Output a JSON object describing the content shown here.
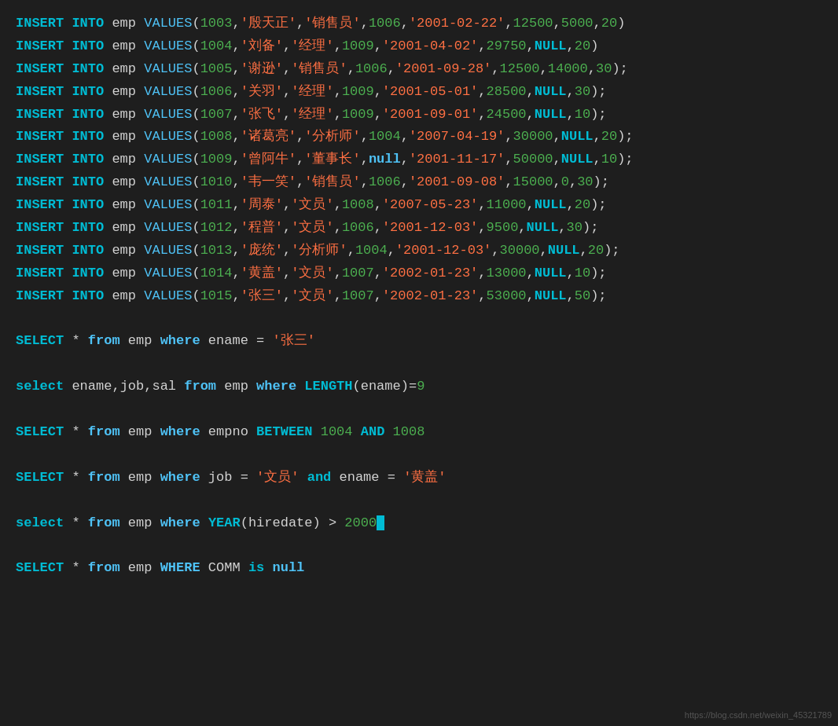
{
  "lines": [
    {
      "id": "l1",
      "text": "INSERT INTO emp VALUES(1003,'殷天正','销售员',1006,'2001-02-22',12500,5000,20)"
    },
    {
      "id": "l2",
      "text": "INSERT INTO emp VALUES(1004,'刘备','经理',1009,'2001-04-02',29750,NULL,20)"
    },
    {
      "id": "l3",
      "text": "INSERT INTO emp VALUES(1005,'谢逊','销售员',1006,'2001-09-28',12500,14000,30);"
    },
    {
      "id": "l4",
      "text": "INSERT INTO emp VALUES(1006,'关羽','经理',1009,'2001-05-01',28500,NULL,30);"
    },
    {
      "id": "l5",
      "text": "INSERT INTO emp VALUES(1007,'张飞','经理',1009,'2001-09-01',24500,NULL,10);"
    },
    {
      "id": "l6",
      "text": "INSERT INTO emp VALUES(1008,'诸葛亮','分析师',1004,'2007-04-19',30000,NULL,20);"
    },
    {
      "id": "l7",
      "text": "INSERT INTO emp VALUES(1009,'曾阿牛','董事长',null,'2001-11-17',50000,NULL,10);"
    },
    {
      "id": "l8",
      "text": "INSERT INTO emp VALUES(1010,'韦一笑','销售员',1006,'2001-09-08',15000,0,30);"
    },
    {
      "id": "l9",
      "text": "INSERT INTO emp VALUES(1011,'周泰','文员',1008,'2007-05-23',11000,NULL,20);"
    },
    {
      "id": "l10",
      "text": "INSERT INTO emp VALUES(1012,'程普','文员',1006,'2001-12-03',9500,NULL,30);"
    },
    {
      "id": "l11",
      "text": "INSERT INTO emp VALUES(1013,'庞统','分析师',1004,'2001-12-03',30000,NULL,20);"
    },
    {
      "id": "l12",
      "text": "INSERT INTO emp VALUES(1014,'黄盖','文员',1007,'2002-01-23',13000,NULL,10);"
    },
    {
      "id": "l13",
      "text": "INSERT INTO emp VALUES(1015,'张三','文员',1007,'2002-01-23',53000,NULL,50);"
    },
    {
      "id": "blank1",
      "text": ""
    },
    {
      "id": "l14",
      "text": "SELECT * from emp where ename = '张三'"
    },
    {
      "id": "blank2",
      "text": ""
    },
    {
      "id": "l15",
      "text": "select ename,job,sal from emp where LENGTH(ename)=9"
    },
    {
      "id": "blank3",
      "text": ""
    },
    {
      "id": "l16",
      "text": "SELECT * from emp where empno BETWEEN 1004 AND 1008"
    },
    {
      "id": "blank4",
      "text": ""
    },
    {
      "id": "l17",
      "text": "SELECT * from emp where job = '文员' and ename = '黄盖'"
    },
    {
      "id": "blank5",
      "text": ""
    },
    {
      "id": "l18",
      "text": "select * from emp where YEAR(hiredate) > 2000",
      "cursor_after": true
    },
    {
      "id": "blank6",
      "text": ""
    },
    {
      "id": "l19",
      "text": "SELECT * from emp WHERE COMM is null"
    }
  ],
  "watermark": "https://blog.csdn.net/weixin_45321789"
}
